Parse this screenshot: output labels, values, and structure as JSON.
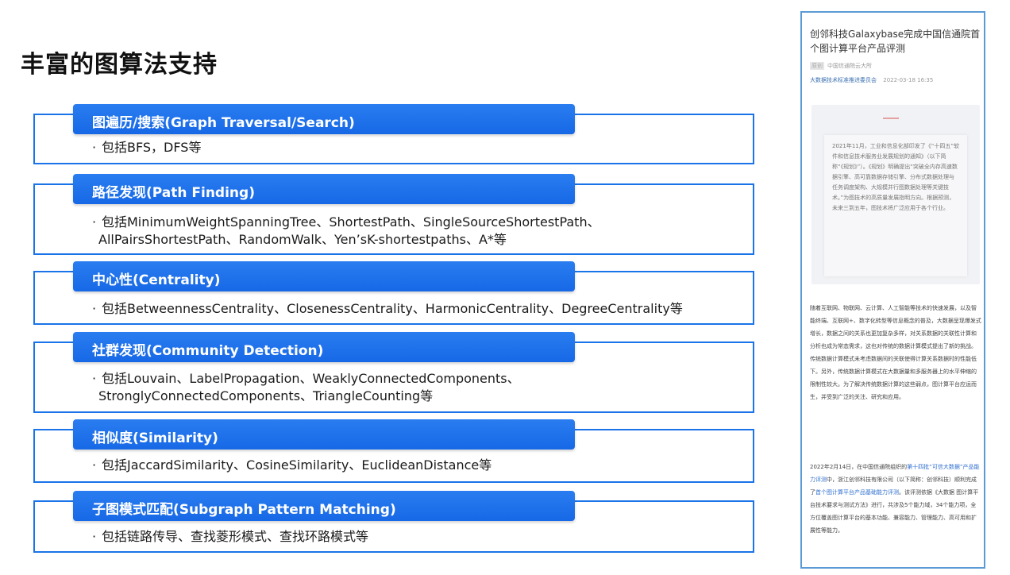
{
  "slide": {
    "title": "丰富的图算法支持"
  },
  "cards": [
    {
      "header": "图遍历/搜索(Graph Traversal/Search)",
      "lines": [
        "包括BFS，DFS等"
      ]
    },
    {
      "header": "路径发现(Path Finding)",
      "lines": [
        "包括MinimumWeightSpanningTree、ShortestPath、SingleSourceShortestPath、",
        "AllPairsShortestPath、RandomWalk、Yen’sK-shortestpaths、A*等"
      ]
    },
    {
      "header": "中心性(Centrality)",
      "lines": [
        "包括BetweennessCentrality、ClosenessCentrality、HarmonicCentrality、DegreeCentrality等"
      ]
    },
    {
      "header": "社群发现(Community Detection)",
      "lines": [
        "包括Louvain、LabelPropagation、WeaklyConnectedComponents、",
        "StronglyConnectedComponents、TriangleCounting等"
      ]
    },
    {
      "header": "相似度(Similarity)",
      "lines": [
        "包括JaccardSimilarity、CosineSimilarity、EuclideanDistance等"
      ]
    },
    {
      "header": "子图模式匹配(Subgraph Pattern Matching)",
      "lines": [
        "包括链路传导、查找菱形模式、查找环路模式等"
      ]
    }
  ],
  "article": {
    "title": "创邻科技Galaxybase完成中国信通院首个图计算平台产品评测",
    "meta_tag": "原创",
    "meta_source": "中国信通院云大所",
    "meta_org": "大数据技术标准推进委员会",
    "meta_time": "2022-03-18 16:35",
    "quote": "2021年11月，工业和信息化部印发了《“十四五”软件和信息技术服务业发展规划的通知》（以下简称“《规划》”）。《规划》明确提出“突破全内存高速数据引擎、高可靠数据存储引擎、分布式数据处理与任务调度架构、大规模并行图数据处理等关键技术。”为图技术的高质量发展指明方向。根据预测，未来三到五年，图技术将广泛应用于各个行业。",
    "para1": "随着互联网、物联网、云计算、人工智能等技术的快速发展，以及智能终端、互联网+、数字化转型等信息概念的普及，大数据呈现爆发式增长，数据之间的关系也更加复杂多样，对关系数据的关联性计算和分析也成为常态需求，这也对传统的数据计算模式提出了新的挑战。传统数据计算模式未考虑数据间的关联使得计算关系数据时的性能低下。另外，传统数据计算模式在大数据量和多服务器上的水平伸缩的限制性较大。为了解决传统数据计算的这些弱点，图计算平台应运而生，并受到广泛的关注、研究和应用。",
    "para2_a": "2022年2月14日，在中国信通院组织的",
    "para2_hl1": "第十四批“可信大数据”产品能力评测",
    "para2_b": "中，浙江创邻科技有限公司（以下简称：创邻科技）顺利完成了",
    "para2_hl2": "首个图计算平台产品基础能力评测",
    "para2_c": "。该评测依据《大数据 图计算平台技术要求与测试方法》进行，共涉及5个能力域，34个能力项，全方位覆盖图计算平台的基本功能、兼容能力、管理能力、高可用和扩展性等能力。"
  }
}
